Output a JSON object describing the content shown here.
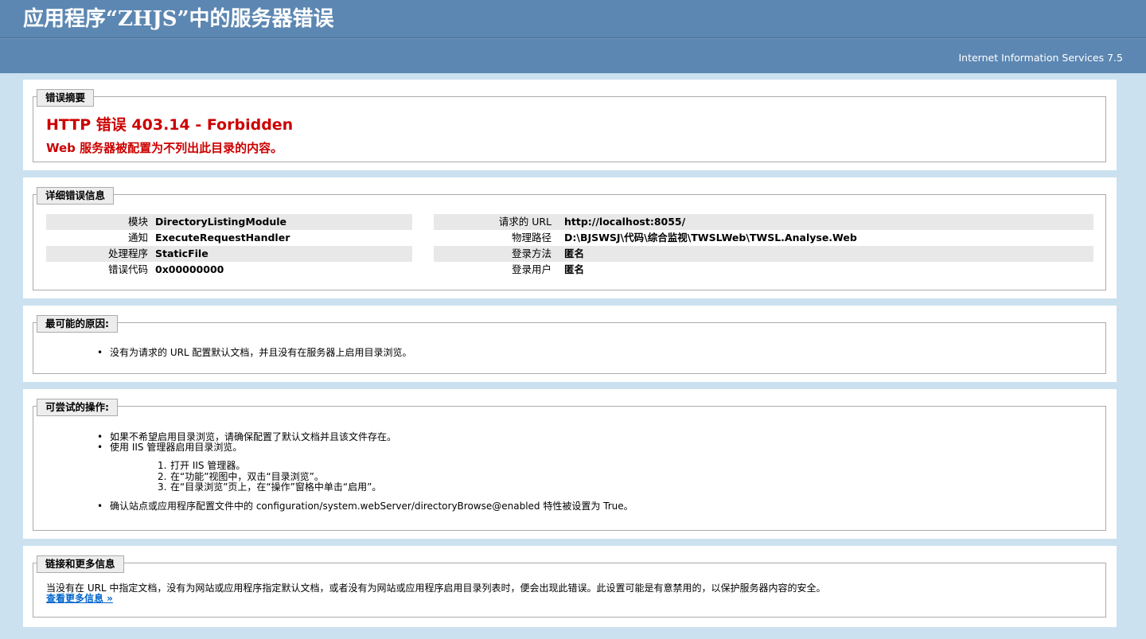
{
  "header": {
    "title": "应用程序“ZHJS”中的服务器错误",
    "server_version": "Internet Information Services 7.5"
  },
  "summary": {
    "legend": "错误摘要",
    "error_title": "HTTP 错误 403.14 - Forbidden",
    "error_message": "Web 服务器被配置为不列出此目录的内容。"
  },
  "details": {
    "legend": "详细错误信息",
    "left": [
      {
        "label": "模块",
        "value": "DirectoryListingModule"
      },
      {
        "label": "通知",
        "value": "ExecuteRequestHandler"
      },
      {
        "label": "处理程序",
        "value": "StaticFile"
      },
      {
        "label": "错误代码",
        "value": "0x00000000"
      }
    ],
    "right": [
      {
        "label": "请求的 URL",
        "value": "http://localhost:8055/"
      },
      {
        "label": "物理路径",
        "value": "D:\\BJSWSJ\\代码\\综合监视\\TWSLWeb\\TWSL.Analyse.Web"
      },
      {
        "label": "登录方法",
        "value": "匿名"
      },
      {
        "label": "登录用户",
        "value": "匿名"
      }
    ]
  },
  "causes": {
    "legend": "最可能的原因:",
    "items": [
      "没有为请求的 URL 配置默认文档，并且没有在服务器上启用目录浏览。"
    ]
  },
  "actions": {
    "legend": "可尝试的操作:",
    "items": [
      "如果不希望启用目录浏览，请确保配置了默认文档并且该文件存在。",
      "使用 IIS 管理器启用目录浏览。"
    ],
    "steps": [
      {
        "num": "1.",
        "text": "打开 IIS 管理器。"
      },
      {
        "num": "2.",
        "text": "在“功能”视图中，双击“目录浏览”。"
      },
      {
        "num": "3.",
        "text": "在“目录浏览”页上，在“操作”窗格中单击“启用”。"
      }
    ],
    "last_item": "确认站点或应用程序配置文件中的 configuration/system.webServer/directoryBrowse@enabled 特性被设置为 True。"
  },
  "more": {
    "legend": "链接和更多信息",
    "text": "当没有在 URL 中指定文档，没有为网站或应用程序指定默认文档，或者没有为网站或应用程序启用目录列表时，便会出现此错误。此设置可能是有意禁用的，以保护服务器内容的安全。",
    "link": "查看更多信息 »"
  }
}
